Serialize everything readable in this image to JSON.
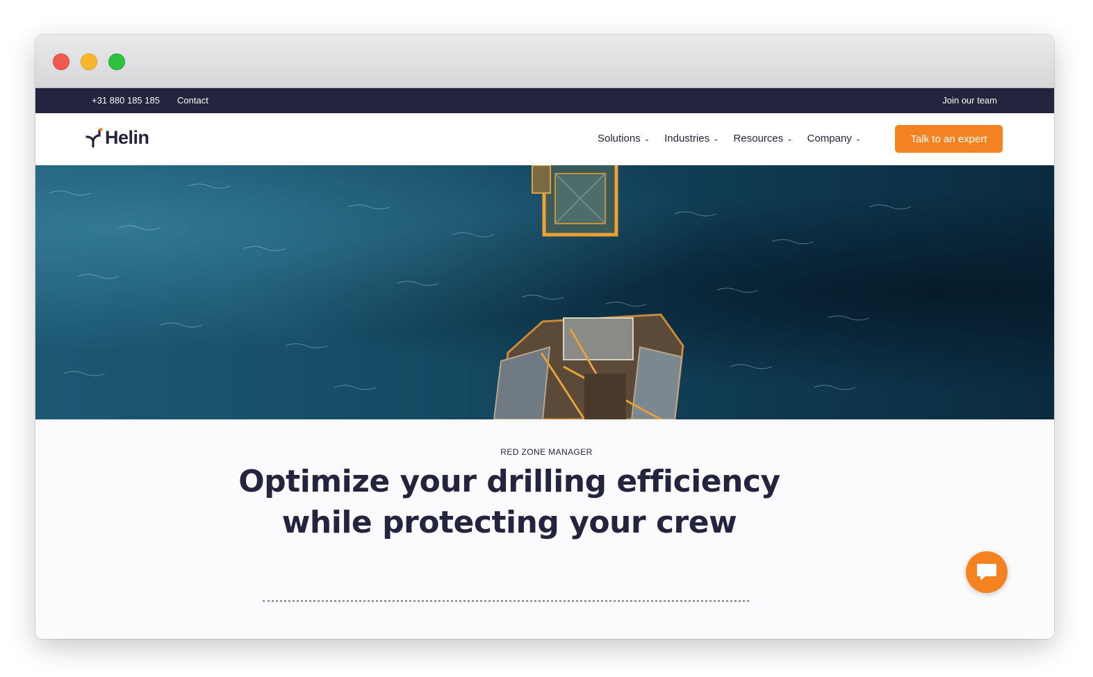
{
  "topbar": {
    "phone": "+31 880 185 185",
    "contact": "Contact",
    "join": "Join our team"
  },
  "nav": {
    "logo": "Helin",
    "items": [
      {
        "label": "Solutions"
      },
      {
        "label": "Industries"
      },
      {
        "label": "Resources"
      },
      {
        "label": "Company"
      }
    ],
    "cta": "Talk to an expert"
  },
  "hero": {
    "eyebrow": "RED ZONE MANAGER",
    "headline": "Optimize your drilling efficiency while protecting your crew"
  },
  "icons": {
    "window_close": "red-circle",
    "window_minimize": "yellow-circle",
    "window_maximize": "green-circle",
    "dropdown": "chevron-down-icon",
    "chat": "chat-bubble-icon"
  },
  "colors": {
    "navy": "#24243f",
    "accent": "#f58220",
    "ocean": "#154a63"
  }
}
